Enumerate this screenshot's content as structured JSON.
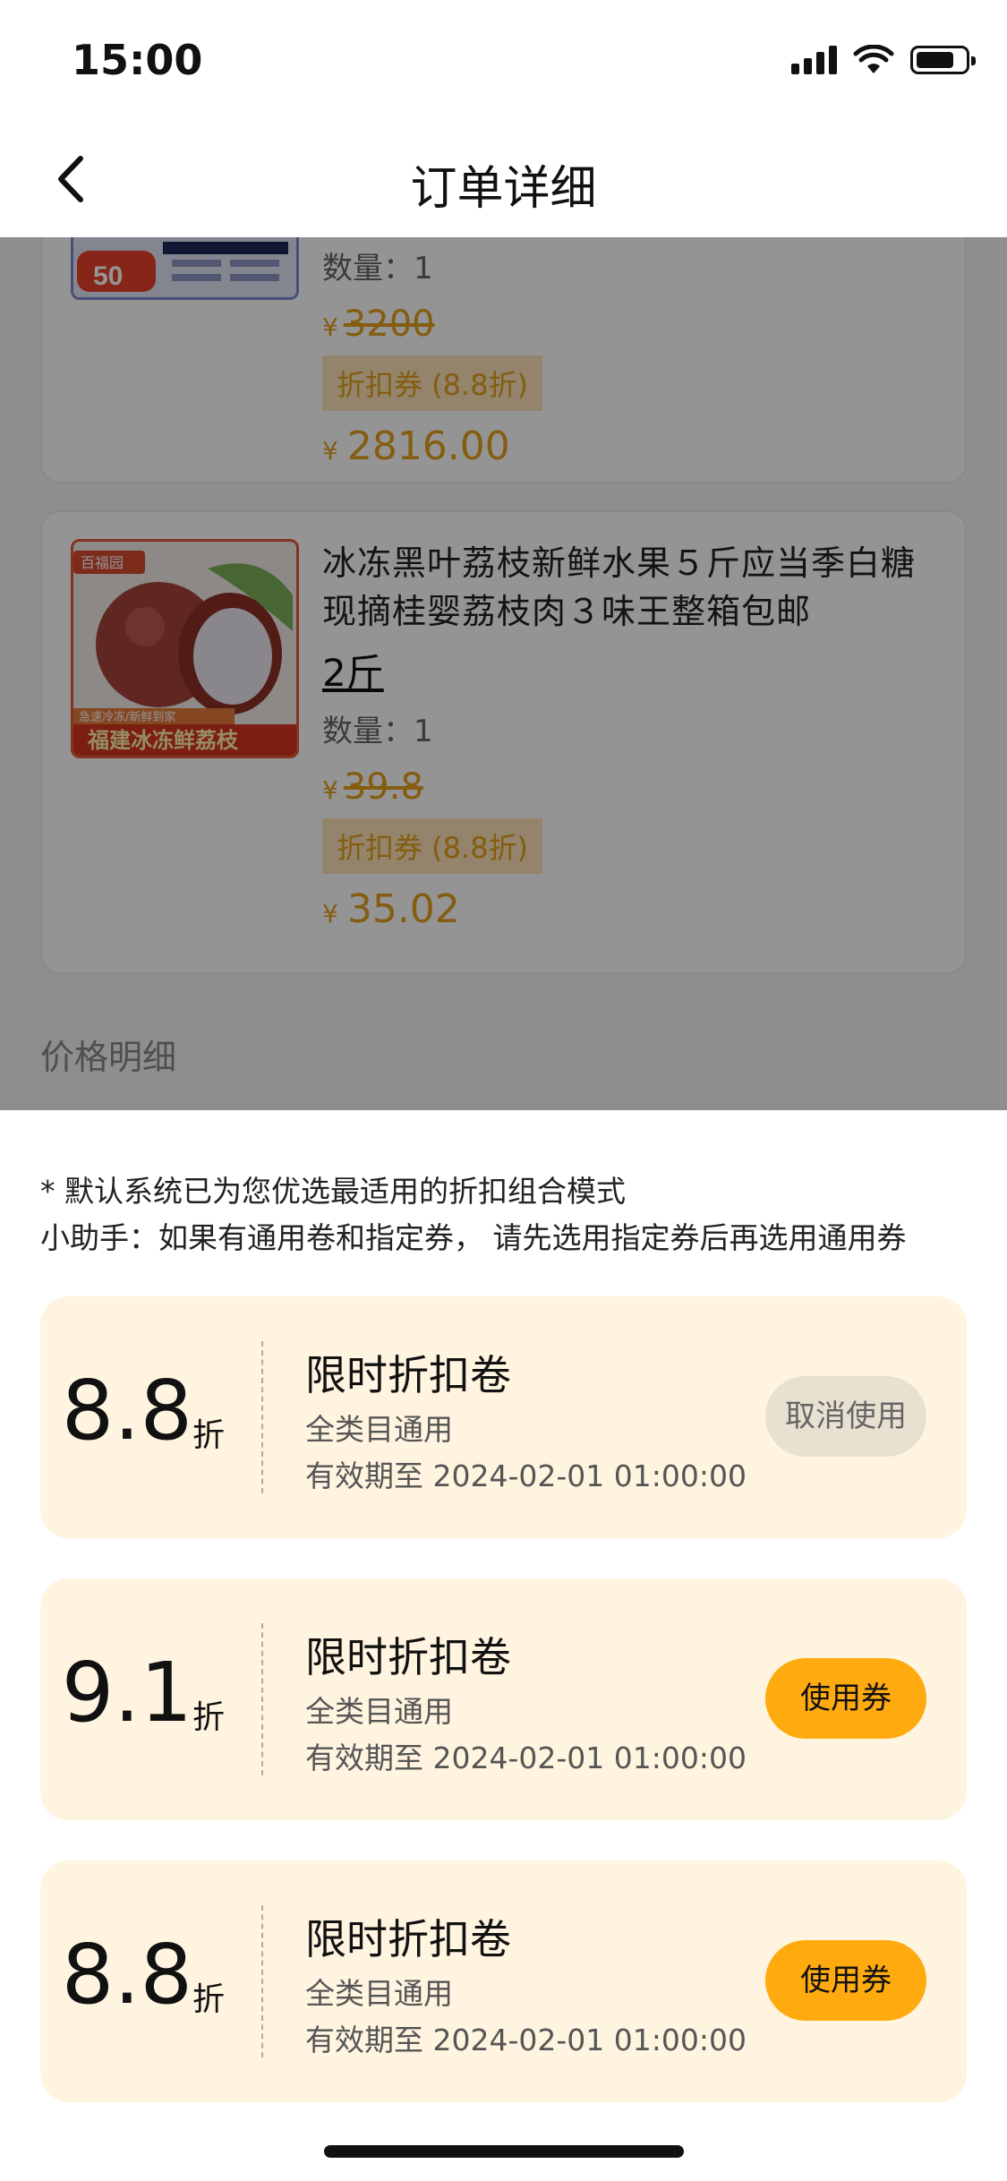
{
  "status_bar": {
    "time": "15:00"
  },
  "nav": {
    "title": "订单详细"
  },
  "products": [
    {
      "quantity_label": "数量：1",
      "currency": "¥",
      "original_price": "3200",
      "coupon_tag": "折扣券 (8.8折)",
      "final_price": "2816.00",
      "thumb_badge": "50"
    },
    {
      "name": "冰冻黑叶荔枝新鲜水果５斤应当季白糖现摘桂婴荔枝肉３味王整箱包邮",
      "spec": "2斤",
      "quantity_label": "数量：1",
      "currency": "¥",
      "original_price": "39.8",
      "coupon_tag": "折扣券 (8.8折)",
      "final_price": "35.02",
      "thumb_banner": "福建冰冻鲜荔枝",
      "thumb_small": "急速冷冻/新鲜到家",
      "thumb_brand": "百福园"
    }
  ],
  "price_section_label": "价格明细",
  "sheet": {
    "tip_line1": "* 默认系统已为您优选最适用的折扣组合模式",
    "tip_line2": "小助手：如果有通用卷和指定券，  请先选用指定券后再选用通用券",
    "vouchers": [
      {
        "discount": "8.8",
        "unit": "折",
        "title": "限时折扣卷",
        "scope": "全类目通用",
        "expiry": "有效期至 2024-02-01 01:00:00",
        "action": "取消使用",
        "state": "selected"
      },
      {
        "discount": "9.1",
        "unit": "折",
        "title": "限时折扣卷",
        "scope": "全类目通用",
        "expiry": "有效期至 2024-02-01 01:00:00",
        "action": "使用券",
        "state": "available"
      },
      {
        "discount": "8.8",
        "unit": "折",
        "title": "限时折扣卷",
        "scope": "全类目通用",
        "expiry": "有效期至 2024-02-01 01:00:00",
        "action": "使用券",
        "state": "available"
      }
    ]
  },
  "colors": {
    "accent": "#ffab0f",
    "price": "#e3a11c",
    "voucher_bg": "#fff4df"
  }
}
